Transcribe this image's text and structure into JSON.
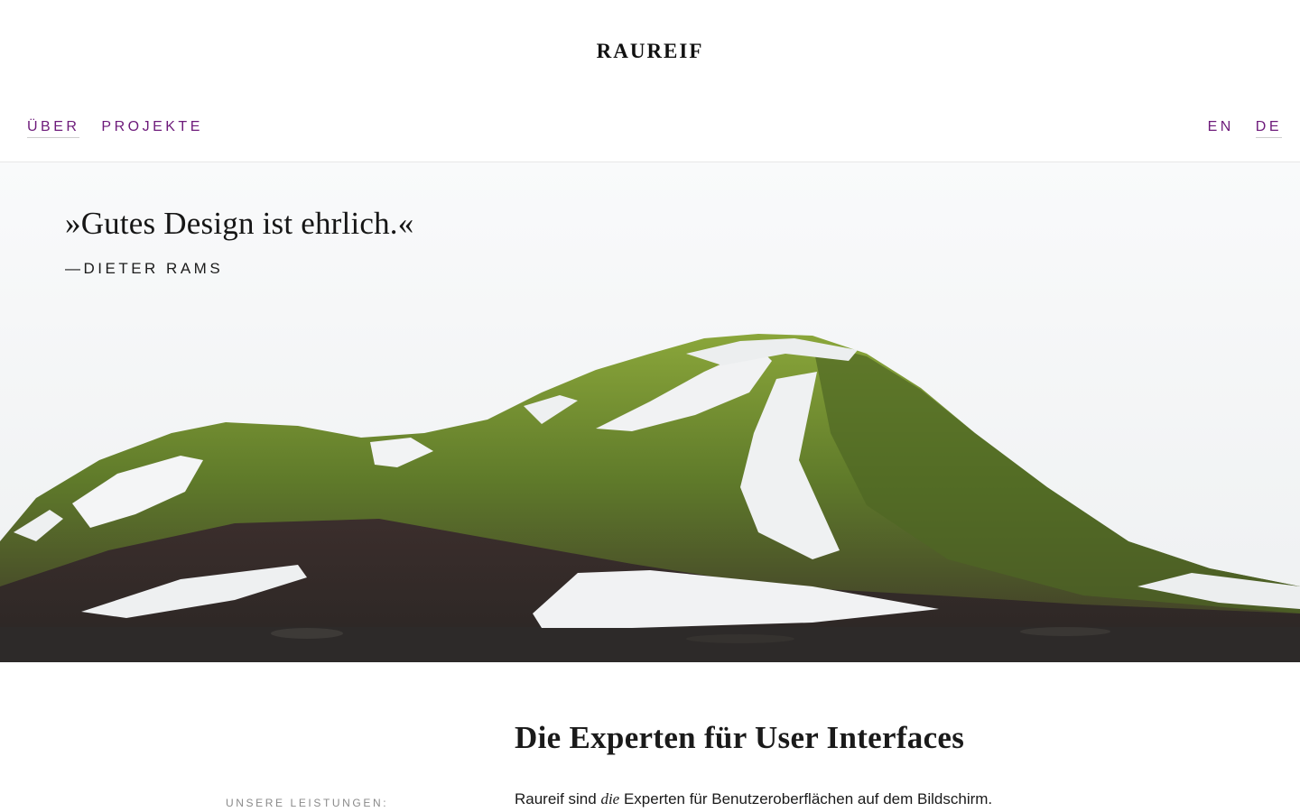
{
  "header": {
    "logo": "RAUREIF",
    "nav_left": [
      {
        "label": "ÜBER",
        "active": true
      },
      {
        "label": "PROJEKTE",
        "active": false
      }
    ],
    "nav_right": [
      {
        "label": "EN",
        "active": false
      },
      {
        "label": "DE",
        "active": true
      }
    ]
  },
  "hero": {
    "quote": "»Gutes Design ist ehrlich.«",
    "author": "—DIETER RAMS"
  },
  "main": {
    "title": "Die Experten für User Interfaces",
    "services_label": "UNSERE LEISTUNGEN:",
    "intro_before": "Raureif sind ",
    "intro_emphasis": "die",
    "intro_after": " Experten für Benutzeroberflächen auf dem Bildschirm."
  },
  "colors": {
    "accent": "#6d1a7a",
    "text": "#1a1a1a",
    "muted": "#8a8a8a"
  }
}
